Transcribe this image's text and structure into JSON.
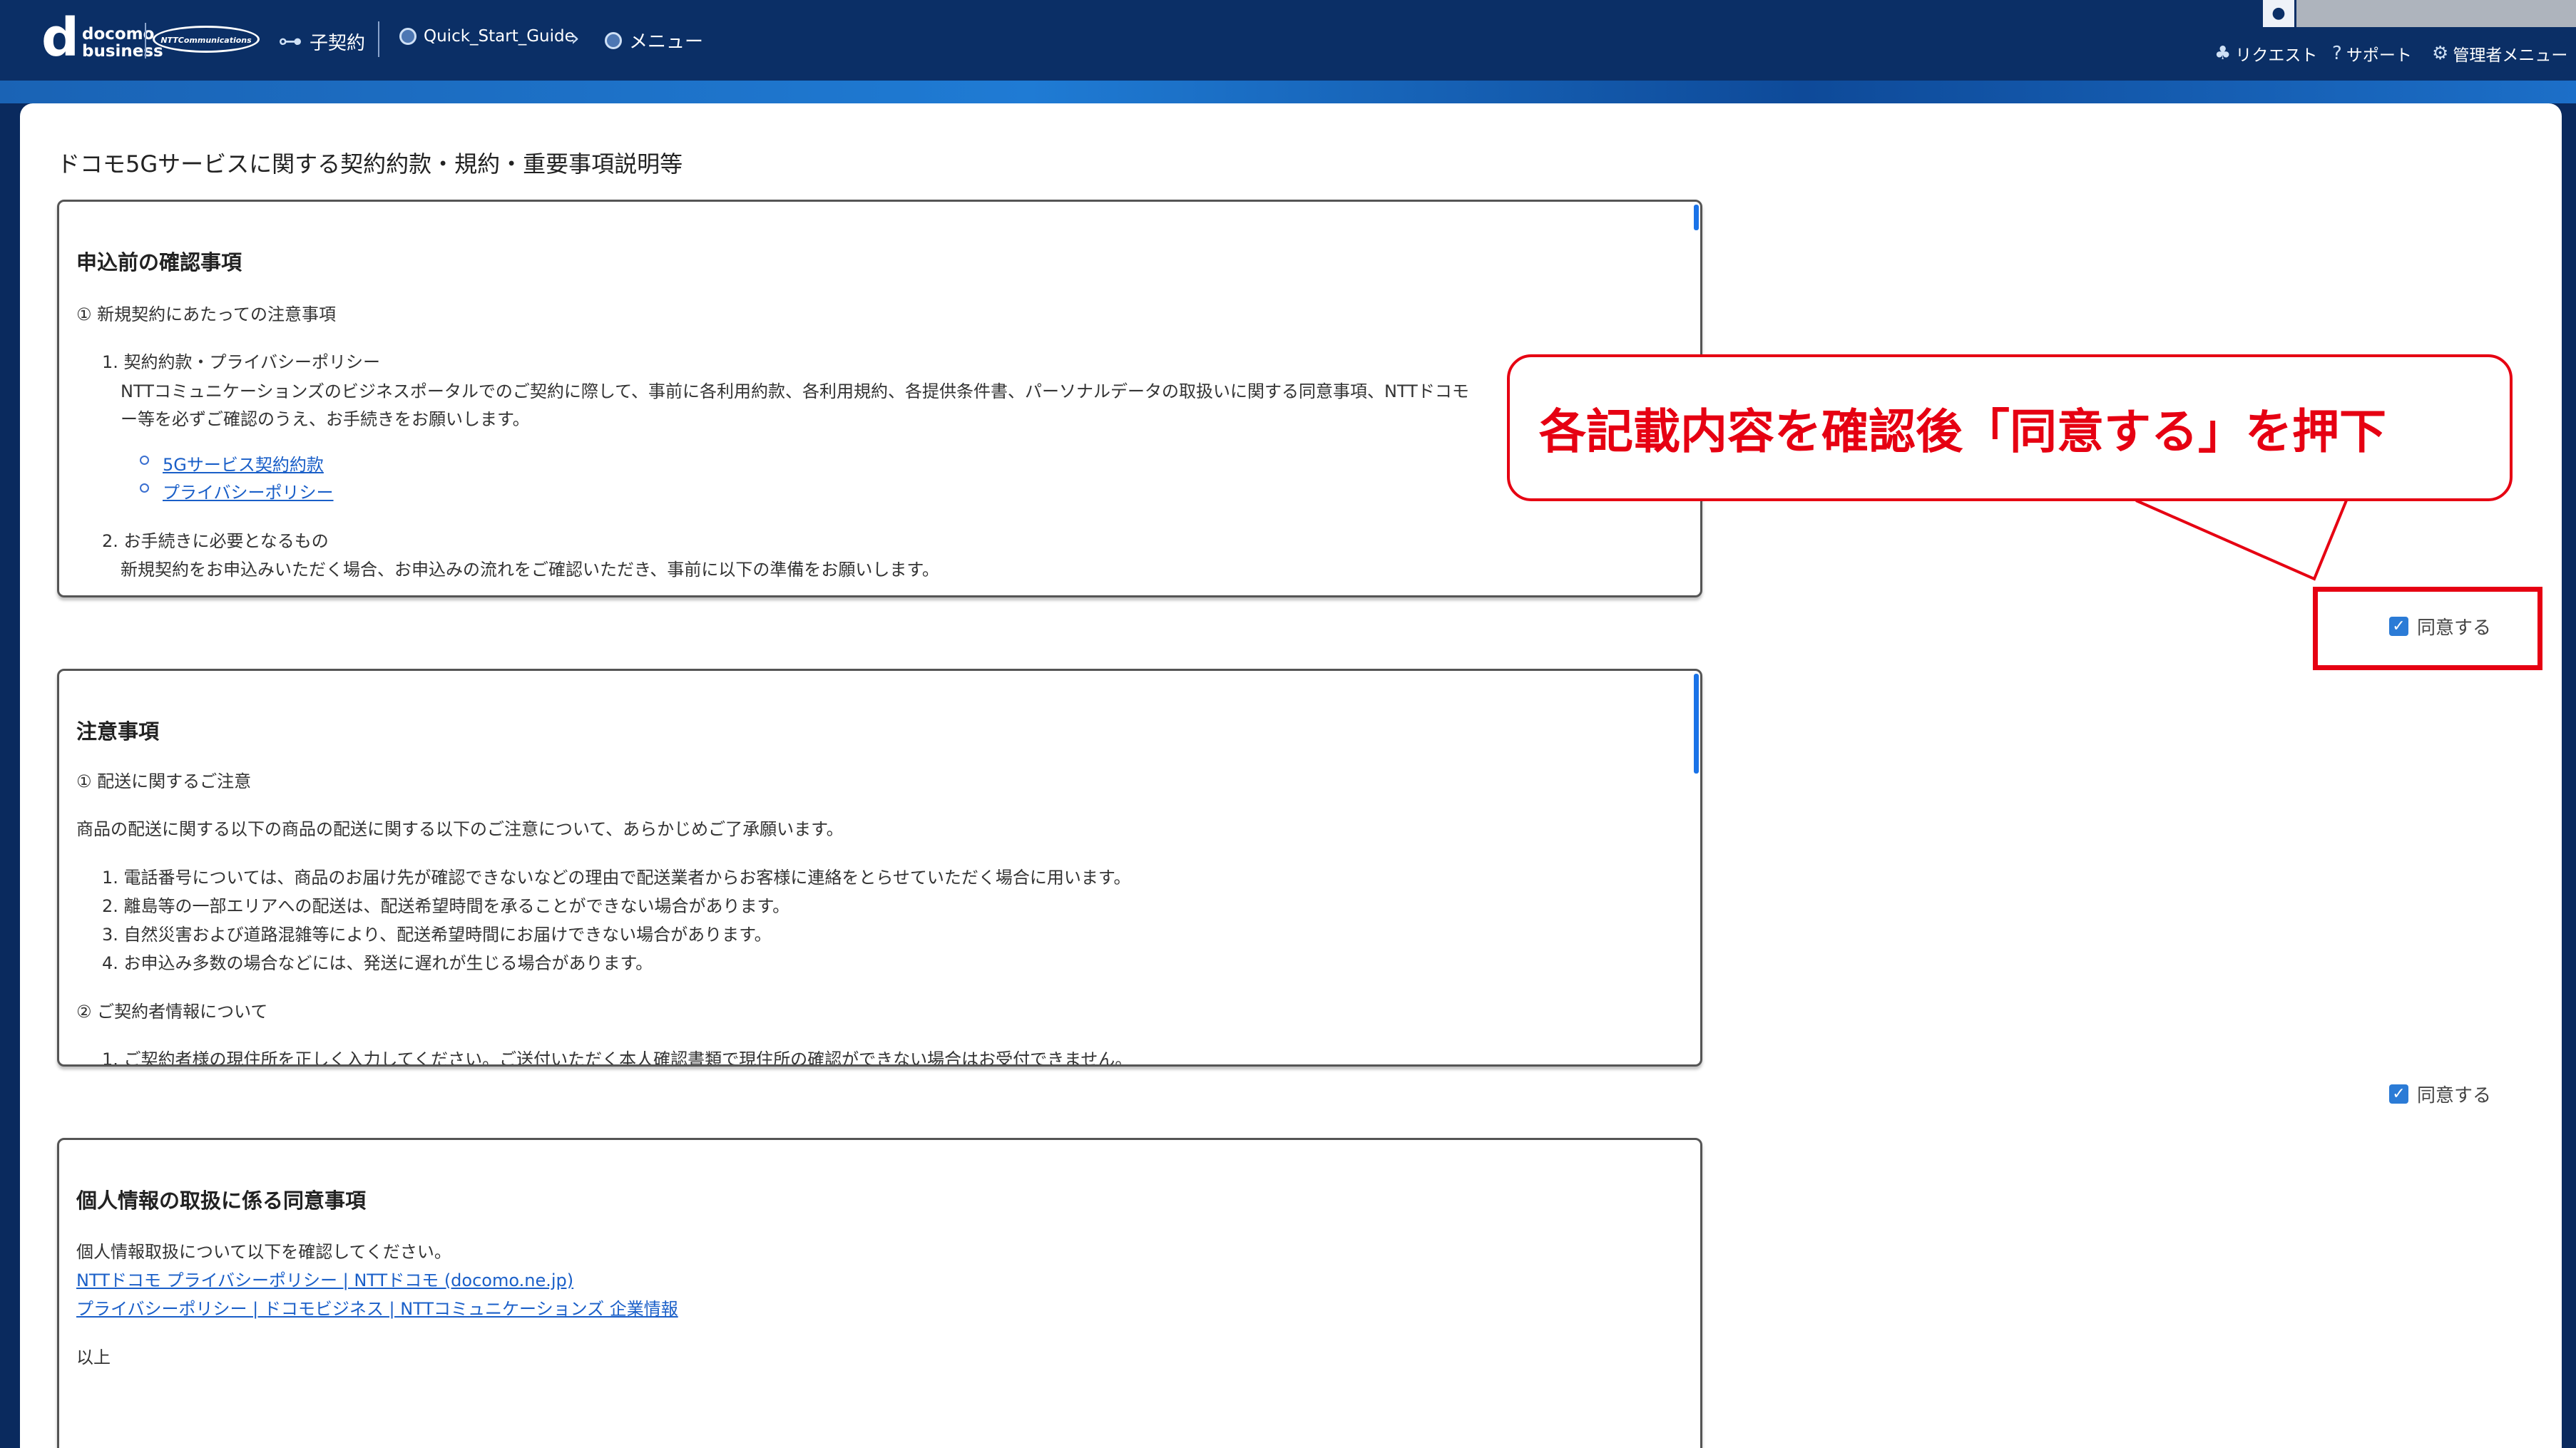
{
  "header": {
    "logo_d": "d",
    "logo_line1": "docomo",
    "logo_line2": "business",
    "ntt_logo": "NTTCommunications",
    "nav_contract": "子契約",
    "nav_guide": "Quick_Start_Guide",
    "nav_menu": "メニュー",
    "request": "リクエスト",
    "support": "サポート",
    "admin_menu": "管理者メニュー"
  },
  "page": {
    "title": "ドコモ5Gサービスに関する契約約款・規約・重要事項説明等"
  },
  "card1": {
    "heading": "申込前の確認事項",
    "sub1": "① 新規契約にあたっての注意事項",
    "item1": "1. 契約約款・プライバシーポリシー",
    "item1_text1": "NTTコミュニケーションズのビジネスポータルでのご契約に際して、事前に各利用約款、各利用規約、各提供条件書、パーソナルデータの取扱いに関する同意事項、NTTドコモ",
    "item1_text2": "ー等を必ずご確認のうえ、お手続きをお願いします。",
    "link1": "5Gサービス契約約款",
    "link2": "プライバシーポリシー",
    "item2": "2. お手続きに必要となるもの",
    "item2_text": "新規契約をお申込みいただく場合、お申込みの流れをご確認いただき、事前に以下の準備をお願いします。"
  },
  "card2": {
    "heading": "注意事項",
    "sub1": "① 配送に関するご注意",
    "intro": "商品の配送に関する以下の商品の配送に関する以下のご注意について、あらかじめご了承願います。",
    "items": [
      "1. 電話番号については、商品のお届け先が確認できないなどの理由で配送業者からお客様に連絡をとらせていただく場合に用います。",
      "2. 離島等の一部エリアへの配送は、配送希望時間を承ることができない場合があります。",
      "3. 自然災害および道路混雑等により、配送希望時間にお届けできない場合があります。",
      "4. お申込み多数の場合などには、発送に遅れが生じる場合があります。"
    ],
    "sub2": "② ご契約者情報について",
    "sub2_item": "1. ご契約者様の現住所を正しく入力してください。ご送付いただく本人確認書類で現住所の確認ができない場合はお受付できません。"
  },
  "card3": {
    "heading": "個人情報の取扱に係る同意事項",
    "text1": "個人情報取扱について以下を確認してください。",
    "link1": "NTTドコモ プライバシーポリシー | NTTドコモ (docomo.ne.jp)",
    "link2": "プライバシーポリシー | ドコモビジネス | NTTコミュニケーションズ 企業情報",
    "end": "以上"
  },
  "agree1": {
    "label": "同意する",
    "checked": true
  },
  "agree2": {
    "label": "同意する",
    "checked": true
  },
  "annotation": {
    "text": "各記載内容を確認後「同意する」を押下",
    "color": "#e60012"
  },
  "icons": {
    "user": "user-icon",
    "bell": "bell-icon",
    "help": "help-circle-icon",
    "gear": "gear-icon",
    "check": "check-icon"
  }
}
